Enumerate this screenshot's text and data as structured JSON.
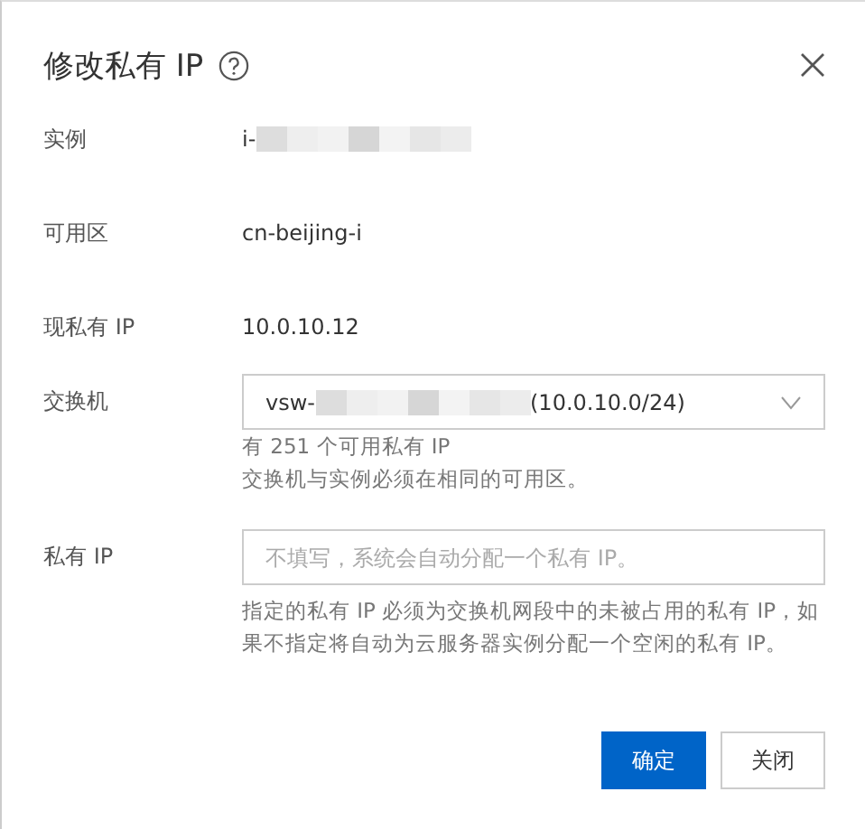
{
  "dialog": {
    "title": "修改私有 IP"
  },
  "fields": [
    {
      "kind": "text",
      "label": "实例",
      "value": "i-",
      "redacted": true
    },
    {
      "kind": "text",
      "label": "可用区",
      "value": "cn-beijing-i"
    },
    {
      "kind": "text",
      "label": "现私有 IP",
      "value": "10.0.10.12"
    },
    {
      "kind": "select",
      "label": "交换机",
      "value": "vsw-",
      "value_suffix": "(10.0.10.0/24)",
      "redacted": true,
      "help": [
        "有 251 个可用私有 IP",
        "交换机与实例必须在相同的可用区。"
      ]
    },
    {
      "kind": "input",
      "label": "私有 IP",
      "placeholder": "不填写，系统会自动分配一个私有 IP。",
      "help": [
        "指定的私有 IP 必须为交换机网段中的未被占用的私有 IP，如果不指定将自动为云服务器实例分配一个空闲的私有 IP。"
      ]
    }
  ],
  "buttons": [
    {
      "label": "确定",
      "primary": true
    },
    {
      "label": "关闭",
      "primary": false
    }
  ]
}
